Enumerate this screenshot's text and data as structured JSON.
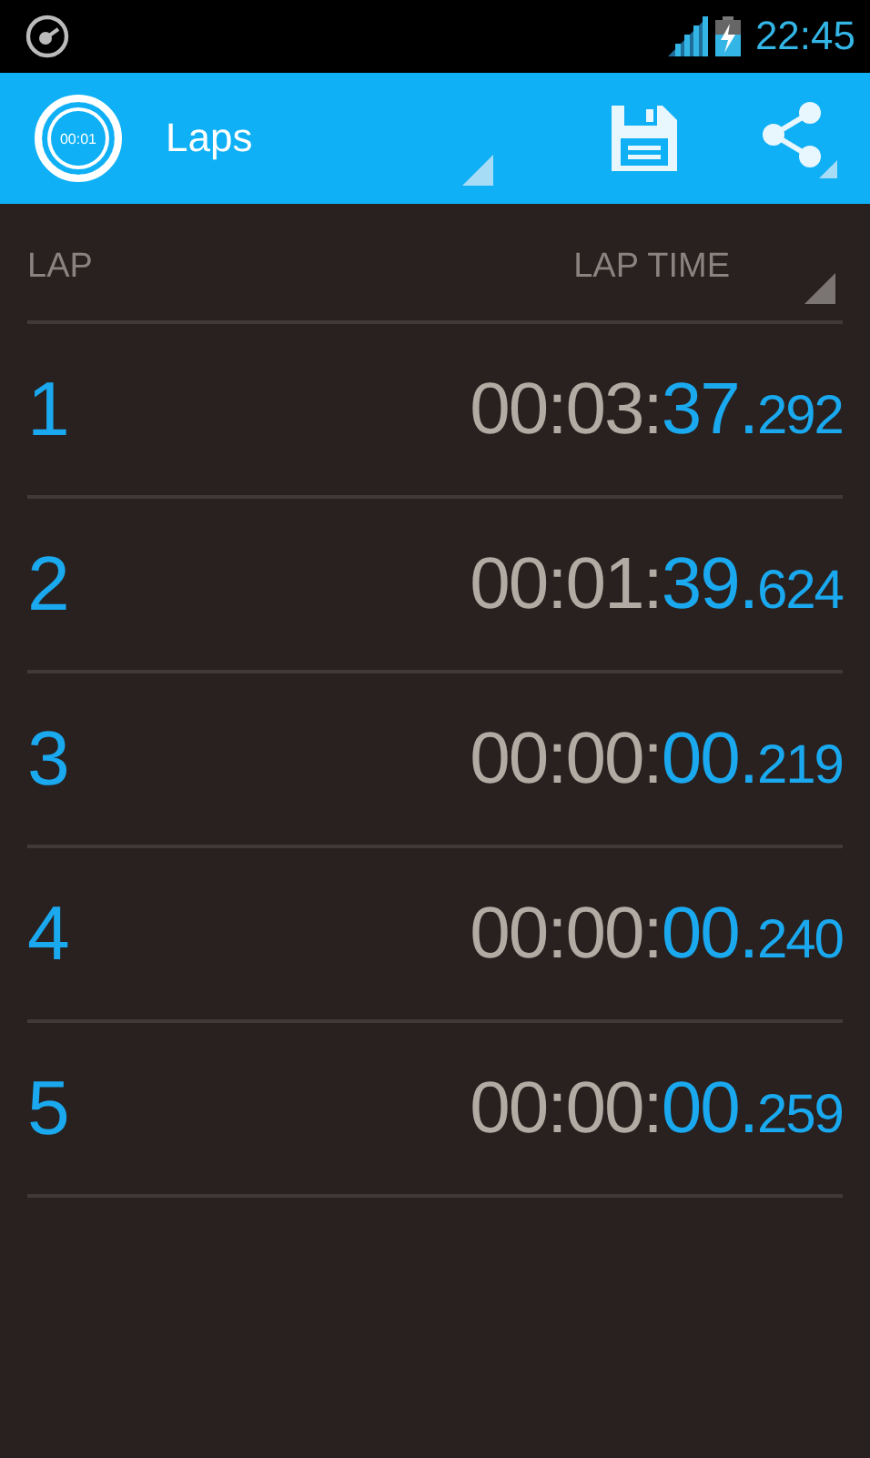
{
  "status_bar": {
    "time": "22:45"
  },
  "action_bar": {
    "logo_text": "00:01",
    "title": "Laps"
  },
  "table": {
    "columns": [
      "LAP",
      "LAP TIME"
    ],
    "rows": [
      {
        "lap": "1",
        "time_prefix": "00:03:",
        "seconds": "37.",
        "millis": "292"
      },
      {
        "lap": "2",
        "time_prefix": "00:01:",
        "seconds": "39.",
        "millis": "624"
      },
      {
        "lap": "3",
        "time_prefix": "00:00:",
        "seconds": "00.",
        "millis": "219"
      },
      {
        "lap": "4",
        "time_prefix": "00:00:",
        "seconds": "00.",
        "millis": "240"
      },
      {
        "lap": "5",
        "time_prefix": "00:00:",
        "seconds": "00.",
        "millis": "259"
      }
    ]
  }
}
